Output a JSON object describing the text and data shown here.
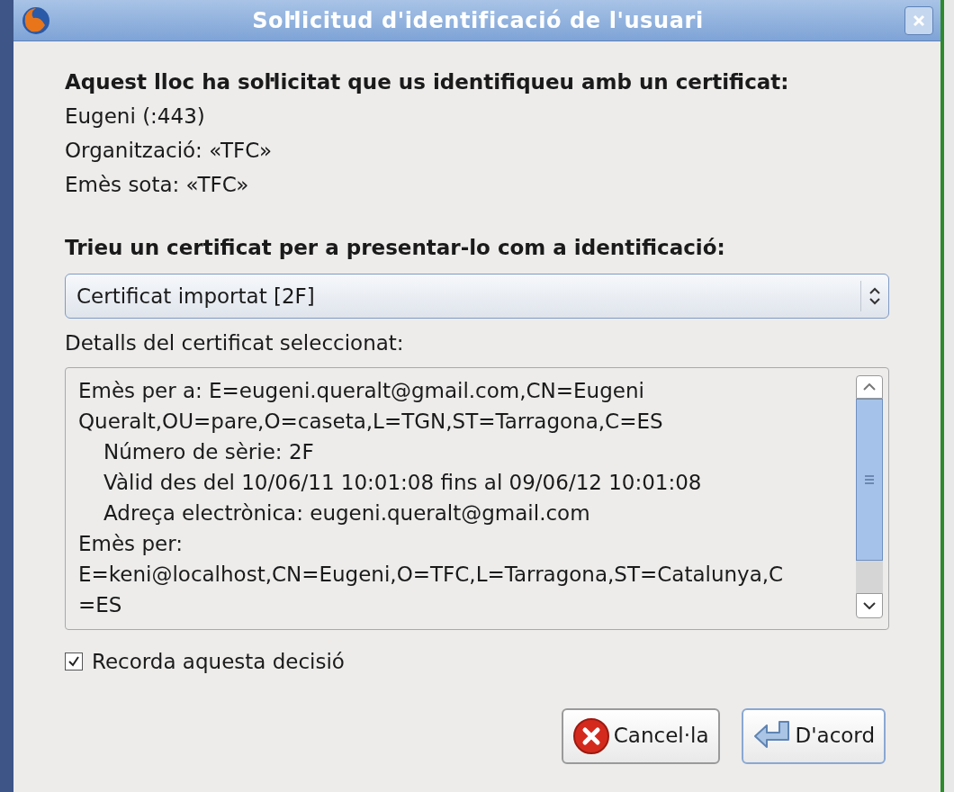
{
  "window": {
    "title": "Soŀlicitud d'identificació de l'usuari"
  },
  "request": {
    "heading": "Aquest lloc ha soŀlicitat que us identifiqueu amb un certificat:",
    "lines": [
      "Eugeni (:443)",
      "Organització: «TFC»",
      "Emès sota: «TFC»"
    ]
  },
  "choose": {
    "heading": "Trieu un certificat per a presentar-lo com a identificació:",
    "select_value": "Certificat importat [2F]"
  },
  "details": {
    "label": "Detalls del certificat seleccionat:",
    "entries": [
      {
        "lines": [
          "Emès per a: E=eugeni.queralt@gmail.com,CN=Eugeni",
          "Queralt,OU=pare,O=caseta,L=TGN,ST=Tarragona,C=ES"
        ],
        "children": [
          {
            "lines": [
              "Número de sèrie: 2F"
            ]
          },
          {
            "lines": [
              "Vàlid des del 10/06/11 10:01:08 fins al 09/06/12 10:01:08"
            ]
          },
          {
            "lines": [
              "Adreça electrònica: eugeni.queralt@gmail.com"
            ]
          }
        ]
      },
      {
        "lines": [
          "Emès per:",
          "E=keni@localhost,CN=Eugeni,O=TFC,L=Tarragona,ST=Catalunya,C",
          "=ES"
        ]
      }
    ]
  },
  "remember": {
    "label": "Recorda aquesta decisió",
    "checked": true
  },
  "buttons": [
    {
      "label": "Cancel·la",
      "kind": "cancel",
      "selected": false
    },
    {
      "label": "D'acord",
      "kind": "ok",
      "selected": true
    }
  ]
}
